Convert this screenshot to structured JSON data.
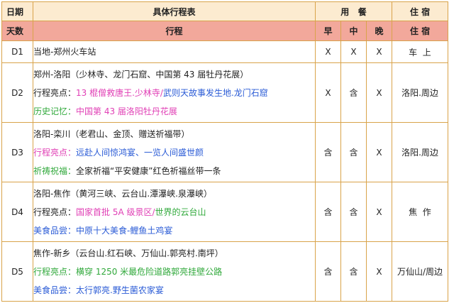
{
  "header": {
    "row1": {
      "date": "日期",
      "schedule": "具体行程表",
      "meals": "用   餐",
      "stay": "住 宿"
    },
    "row2": {
      "days": "天数",
      "itinerary": "行程",
      "breakfast": "早",
      "lunch": "中",
      "dinner": "晚",
      "stay": "住 宿"
    }
  },
  "days": [
    {
      "day": "D1",
      "lines": [
        [
          {
            "t": "当地-郑州火车站",
            "c": "dark"
          }
        ]
      ],
      "breakfast": "X",
      "lunch": "X",
      "dinner": "X",
      "hotel": "车  上"
    },
    {
      "day": "D2",
      "lines": [
        [
          {
            "t": "郑州-洛阳（少林寺、龙门石窟、中国第 43 届牡丹花展）",
            "c": "dark"
          }
        ],
        [
          {
            "t": "行程亮点：",
            "c": "dark"
          },
          {
            "t": "13 棍僧救唐王.少林寺/",
            "c": "pink"
          },
          {
            "t": "武则天故事发生地.龙门石窟",
            "c": "blue"
          }
        ],
        [
          {
            "t": "历史记忆：",
            "c": "green"
          },
          {
            "t": "中国第 43 届洛阳牡丹花展",
            "c": "pink"
          }
        ]
      ],
      "breakfast": "X",
      "lunch": "含",
      "dinner": "X",
      "hotel": "洛阳.周边"
    },
    {
      "day": "D3",
      "lines": [
        [
          {
            "t": "洛阳-栾川（老君山、金顶、赠送祈福带）",
            "c": "dark"
          }
        ],
        [
          {
            "t": "行程亮点：",
            "c": "pink"
          },
          {
            "t": "远赴人间惊鸿宴、一览人间盛世颜",
            "c": "blue"
          }
        ],
        [
          {
            "t": "祈祷祝福：",
            "c": "green"
          },
          {
            "t": "全家祈福“平安健康”红色祈福丝带一条",
            "c": "dark"
          }
        ]
      ],
      "breakfast": "含",
      "lunch": "含",
      "dinner": "X",
      "hotel": "洛阳.周边"
    },
    {
      "day": "D4",
      "lines": [
        [
          {
            "t": "洛阳-焦作（黄河三峡、云台山.潭瀑峡.泉瀑峡）",
            "c": "dark"
          }
        ],
        [
          {
            "t": "行程亮点：",
            "c": "dark"
          },
          {
            "t": "国家首批 5A 级景区/",
            "c": "pink"
          },
          {
            "t": "世界的云台山",
            "c": "green"
          }
        ],
        [
          {
            "t": "美食品尝：",
            "c": "blue"
          },
          {
            "t": "中原十大美食-鲤鱼土鸡宴",
            "c": "blue"
          }
        ]
      ],
      "breakfast": "含",
      "lunch": "含",
      "dinner": "X",
      "hotel": "焦  作"
    },
    {
      "day": "D5",
      "lines": [
        [
          {
            "t": "焦作-新乡（云台山.红石峡、万仙山.郭亮村.南坪）",
            "c": "dark"
          }
        ],
        [
          {
            "t": "行程亮点：",
            "c": "green"
          },
          {
            "t": "横穿 1250 米最危险道路郭亮挂壁公路",
            "c": "green"
          }
        ],
        [
          {
            "t": "美食品尝：",
            "c": "blue"
          },
          {
            "t": "太行郭亮.野生菌农家宴",
            "c": "blue"
          }
        ]
      ],
      "breakfast": "含",
      "lunch": "含",
      "dinner": "X",
      "hotel": "万仙山/周边"
    }
  ]
}
